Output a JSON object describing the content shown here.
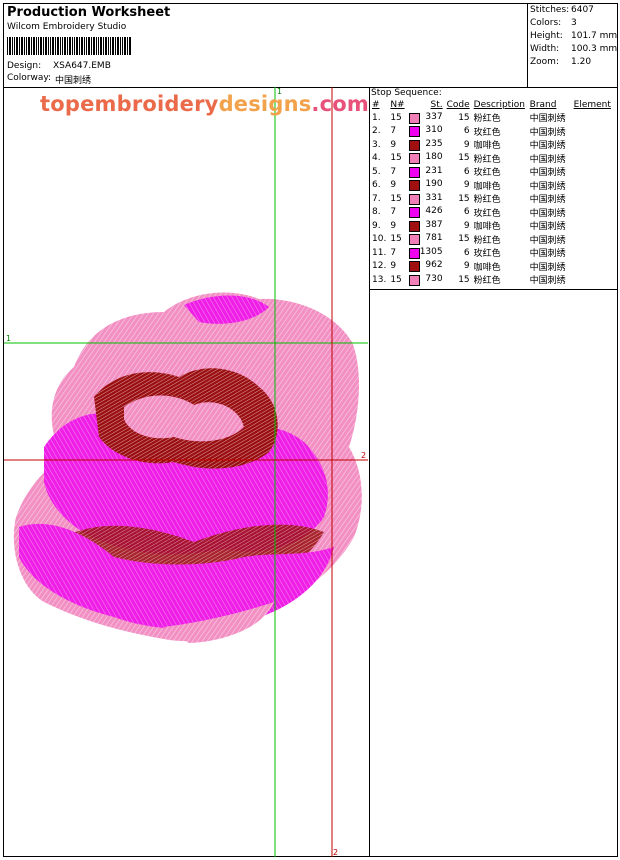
{
  "header": {
    "title": "Production Worksheet",
    "company": "Wilcom  Embroidery Studio",
    "design_label": "Design:",
    "design_value": "XSA647.EMB",
    "colorway_label": "Colorway:",
    "colorway_value": "中国刺绣"
  },
  "stats": [
    {
      "label": "Stitches:",
      "value": "6407"
    },
    {
      "label": "Colors:",
      "value": "3"
    },
    {
      "label": "Height:",
      "value": "101.7 mm"
    },
    {
      "label": "Width:",
      "value": "100.3 mm"
    },
    {
      "label": "Zoom:",
      "value": "1.20"
    }
  ],
  "watermark": {
    "part1": "topembroidery",
    "part2": "designs",
    "part3": ".com"
  },
  "guides": {
    "green_label": "1",
    "red_label": "2"
  },
  "stop_sequence": {
    "title": "Stop Sequence:",
    "columns": [
      "#",
      "N#",
      "St.",
      "Code",
      "Description",
      "Brand",
      "Element"
    ],
    "rows": [
      {
        "num": "1.",
        "n": "15",
        "color": "#f07fb8",
        "st": "337",
        "code": "15",
        "desc": "粉红色",
        "brand": "中国刺绣"
      },
      {
        "num": "2.",
        "n": "7",
        "color": "#f000f0",
        "st": "310",
        "code": "6",
        "desc": "玫红色",
        "brand": "中国刺绣"
      },
      {
        "num": "3.",
        "n": "9",
        "color": "#a01010",
        "st": "235",
        "code": "9",
        "desc": "咖啡色",
        "brand": "中国刺绣"
      },
      {
        "num": "4.",
        "n": "15",
        "color": "#f07fb8",
        "st": "180",
        "code": "15",
        "desc": "粉红色",
        "brand": "中国刺绣"
      },
      {
        "num": "5.",
        "n": "7",
        "color": "#f000f0",
        "st": "231",
        "code": "6",
        "desc": "玫红色",
        "brand": "中国刺绣"
      },
      {
        "num": "6.",
        "n": "9",
        "color": "#a01010",
        "st": "190",
        "code": "9",
        "desc": "咖啡色",
        "brand": "中国刺绣"
      },
      {
        "num": "7.",
        "n": "15",
        "color": "#f07fb8",
        "st": "331",
        "code": "15",
        "desc": "粉红色",
        "brand": "中国刺绣"
      },
      {
        "num": "8.",
        "n": "7",
        "color": "#f000f0",
        "st": "426",
        "code": "6",
        "desc": "玫红色",
        "brand": "中国刺绣"
      },
      {
        "num": "9.",
        "n": "9",
        "color": "#a01010",
        "st": "387",
        "code": "9",
        "desc": "咖啡色",
        "brand": "中国刺绣"
      },
      {
        "num": "10.",
        "n": "15",
        "color": "#f07fb8",
        "st": "781",
        "code": "15",
        "desc": "粉红色",
        "brand": "中国刺绣"
      },
      {
        "num": "11.",
        "n": "7",
        "color": "#f000f0",
        "st": "1305",
        "code": "6",
        "desc": "玫红色",
        "brand": "中国刺绣"
      },
      {
        "num": "12.",
        "n": "9",
        "color": "#a01010",
        "st": "962",
        "code": "9",
        "desc": "咖啡色",
        "brand": "中国刺绣"
      },
      {
        "num": "13.",
        "n": "15",
        "color": "#f07fb8",
        "st": "730",
        "code": "15",
        "desc": "粉红色",
        "brand": "中国刺绣"
      }
    ]
  }
}
